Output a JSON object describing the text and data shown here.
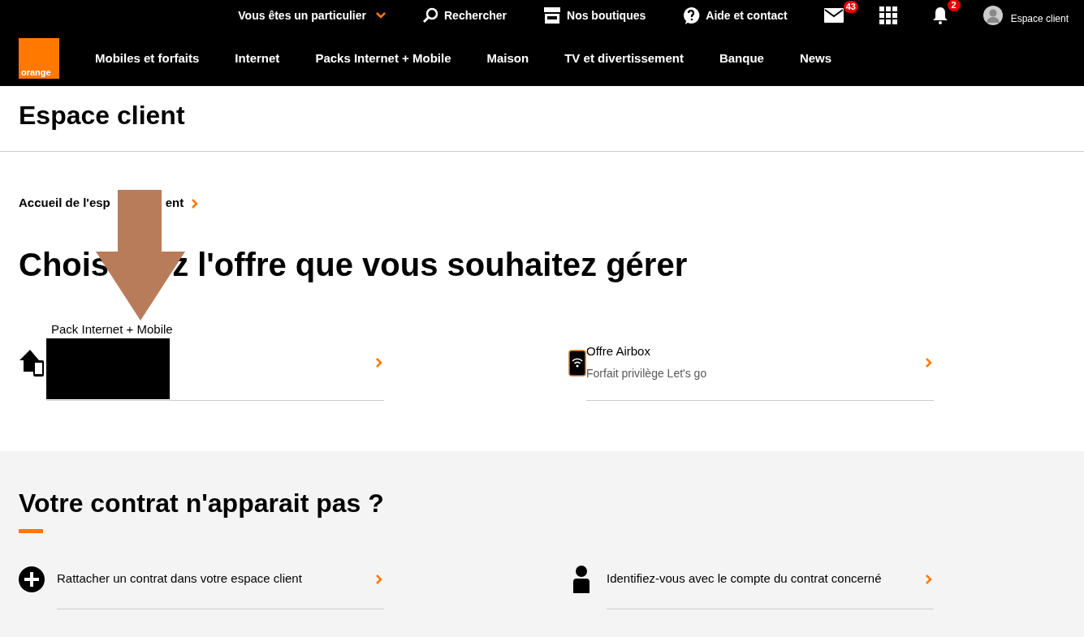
{
  "top_bar": {
    "segment_selector": "Vous êtes un particulier",
    "links": [
      {
        "kind": "search",
        "label": "Rechercher"
      },
      {
        "kind": "shops",
        "label": "Nos boutiques"
      },
      {
        "kind": "help",
        "label": "Aide et contact"
      }
    ],
    "icons": [
      {
        "kind": "mail",
        "badge": "43"
      },
      {
        "kind": "apps"
      },
      {
        "kind": "bell",
        "badge": "2"
      }
    ],
    "account": "Espace client"
  },
  "logo": "orange",
  "nav": [
    "Mobiles et forfaits",
    "Internet",
    "Packs Internet + Mobile",
    "Maison",
    "TV et divertissement",
    "Banque",
    "News"
  ],
  "page_title": "Espace client",
  "breadcrumb_parts": [
    "Accueil de l'esp",
    "ent"
  ],
  "heading_parts": [
    "Chois",
    "z l'offre que vous souhaitez gérer"
  ],
  "offers": [
    {
      "kind": "pack",
      "title": "Pack Internet + Mobile",
      "redacted": true
    },
    {
      "kind": "airbox",
      "title": "Offre Airbox",
      "subtitle": "Forfait privilège Let's go"
    }
  ],
  "missing_section": {
    "title": "Votre contrat n'apparait pas ?",
    "actions": [
      {
        "kind": "add",
        "label": "Rattacher un contrat dans votre espace client"
      },
      {
        "kind": "user",
        "label": "Identifiez-vous avec le compte du contrat concerné"
      }
    ]
  }
}
